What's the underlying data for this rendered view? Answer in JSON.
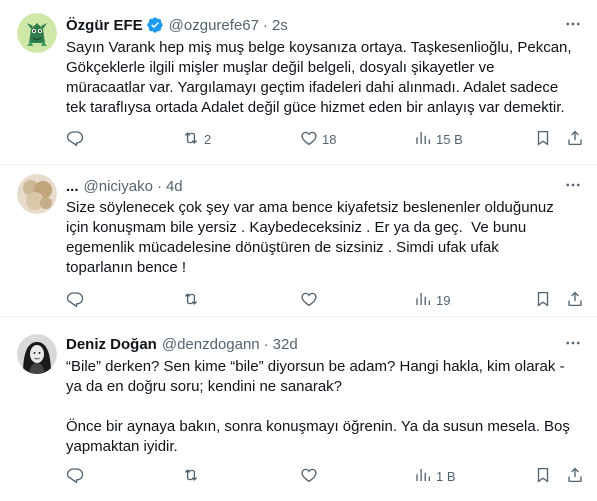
{
  "colors": {
    "text": "#0f1419",
    "muted": "#536471",
    "verified": "#1d9bf0",
    "divider": "#eff3f4"
  },
  "icons": [
    "more-icon",
    "reply-icon",
    "retweet-icon",
    "like-icon",
    "views-icon",
    "bookmark-icon",
    "share-icon",
    "verified-badge-icon"
  ],
  "tweets": [
    {
      "name": "Özgür EFE",
      "verified": true,
      "handle": "@ozgurefe67",
      "time": "2s",
      "text": "Sayın Varank hep miş muş belge koysanıza ortaya. Taşkesenlioğlu, Pekcan,\nGökçeklerle ilgili mişler muşlar değil belgeli, dosyalı şikayetler ve\nmüracaatlar var. Yargılamayı geçtim ifadeleri dahi alınmadı. Adalet sadece\ntek taraflıysa ortada Adalet değil güce hizmet eden bir anlayış var demektir.",
      "replies": "",
      "retweets": "2",
      "likes": "18",
      "views": "15 B"
    },
    {
      "name": "...",
      "verified": false,
      "handle": "@niciyako",
      "time": "4d",
      "text": "Size söylenecek çok şey var ama bence kiyafetsiz beslenenler olduğunuz\niçin konuşmam bile yersiz . Kaybedeceksiniz . Er ya da geç.  Ve bunu\negemenlik mücadelesine dönüştüren de sizsiniz . Simdi ufak ufak\ntoparlanın bence !",
      "replies": "",
      "retweets": "",
      "likes": "",
      "views": "19"
    },
    {
      "name": "Deniz Doğan",
      "verified": false,
      "handle": "@denzdogann",
      "time": "32d",
      "text": "“Bile” derken? Sen kime “bile” diyorsun be adam? Hangi hakla, kim olarak -\nya da en doğru soru; kendini ne sanarak?\n\nÖnce bir aynaya bakın, sonra konuşmayı öğrenin. Ya da susun mesela. Boş\nyapmaktan iyidir.",
      "replies": "",
      "retweets": "",
      "likes": "",
      "views": "1 B"
    }
  ]
}
